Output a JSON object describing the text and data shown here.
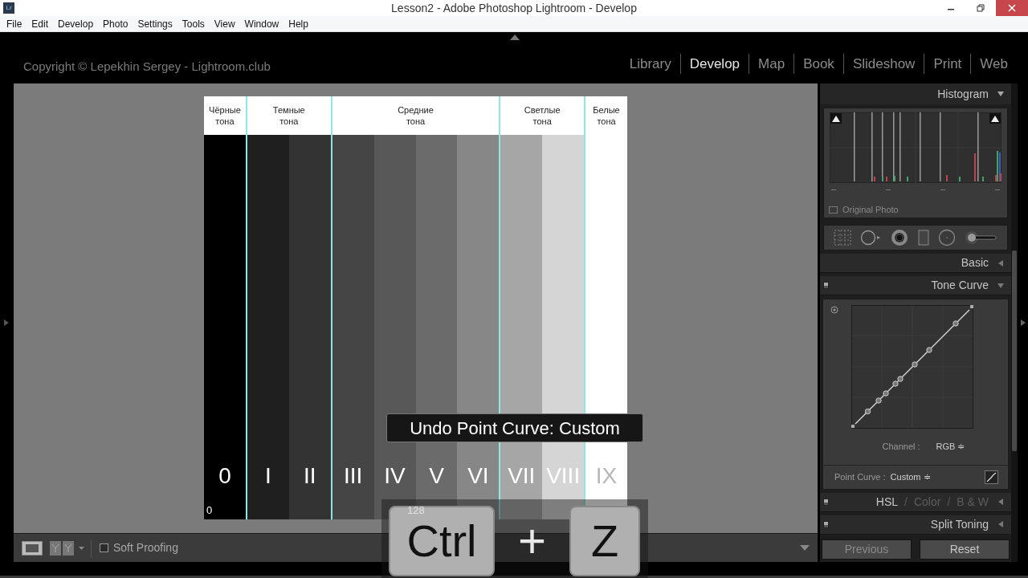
{
  "window": {
    "app_icon": "Lr",
    "title": "Lesson2 - Adobe Photoshop Lightroom - Develop"
  },
  "menu": [
    "File",
    "Edit",
    "Develop",
    "Photo",
    "Settings",
    "Tools",
    "View",
    "Window",
    "Help"
  ],
  "identity_plate": "Copyright © Lepekhin Sergey - Lightroom.club",
  "modules": [
    {
      "label": "Library",
      "selected": false
    },
    {
      "label": "Develop",
      "selected": true
    },
    {
      "label": "Map",
      "selected": false
    },
    {
      "label": "Book",
      "selected": false
    },
    {
      "label": "Slideshow",
      "selected": false
    },
    {
      "label": "Print",
      "selected": false
    },
    {
      "label": "Web",
      "selected": false
    }
  ],
  "image": {
    "zones": [
      {
        "label": "Чёрные тона",
        "stripes": [
          {
            "numeral": "0",
            "color": "#000000"
          }
        ]
      },
      {
        "label": "Темные тона",
        "stripes": [
          {
            "numeral": "I",
            "color": "#1f1f1f"
          },
          {
            "numeral": "II",
            "color": "#333333"
          }
        ]
      },
      {
        "label": "Средние тона",
        "stripes": [
          {
            "numeral": "III",
            "color": "#454545"
          },
          {
            "numeral": "IV",
            "color": "#585858"
          },
          {
            "numeral": "V",
            "color": "#6b6b6b"
          },
          {
            "numeral": "VI",
            "color": "#878787"
          }
        ]
      },
      {
        "label": "Светлые тона",
        "stripes": [
          {
            "numeral": "VII",
            "color": "#a6a6a6"
          },
          {
            "numeral": "VIII",
            "color": "#d5d5d5"
          }
        ]
      },
      {
        "label": "Белые тона",
        "stripes": [
          {
            "numeral": "IX",
            "color": "#ffffff"
          }
        ]
      }
    ],
    "scale_labels": [
      "0",
      "128"
    ]
  },
  "toast": "Undo Point Curve: Custom",
  "shortcut": {
    "keys": [
      "Ctrl",
      "Z"
    ],
    "joiner": "+"
  },
  "toolbar": {
    "soft_proofing": {
      "label": "Soft Proofing",
      "checked": false
    }
  },
  "right_panel": {
    "histogram": {
      "title": "Histogram",
      "expanded": true,
      "original_photo": {
        "label": "Original Photo",
        "checked": false
      }
    },
    "panels": [
      {
        "title": "Basic",
        "expanded": false,
        "has_switch": false
      },
      {
        "title": "Tone Curve",
        "expanded": true,
        "has_switch": true
      },
      {
        "tabs": [
          {
            "label": "HSL",
            "selected": true
          },
          {
            "label": "Color",
            "selected": false
          },
          {
            "label": "B & W",
            "selected": false
          }
        ],
        "separator": "/",
        "expanded": false,
        "has_switch": true
      },
      {
        "title": "Split Toning",
        "expanded": false,
        "has_switch": true
      }
    ],
    "tone_curve": {
      "channel_label": "Channel :",
      "channel": "RGB ≑",
      "point_curve_label": "Point Curve :",
      "point_curve": "Custom ≑"
    },
    "buttons": [
      {
        "label": "Previous",
        "disabled": true
      },
      {
        "label": "Reset",
        "disabled": false
      }
    ]
  }
}
